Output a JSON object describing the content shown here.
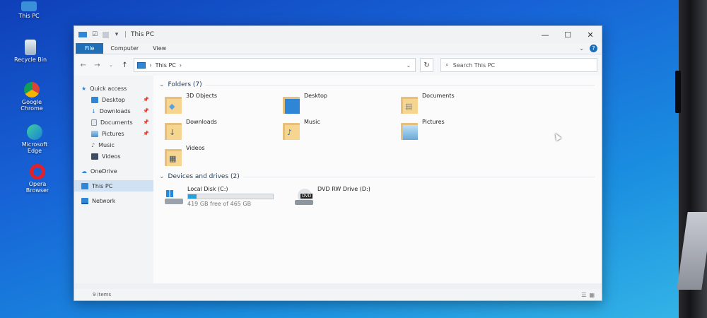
{
  "desktop": {
    "icons": [
      {
        "label": "This PC"
      },
      {
        "label": "Recycle Bin"
      },
      {
        "label": "Google Chrome"
      },
      {
        "label": "Microsoft Edge"
      },
      {
        "label": "Opera Browser"
      }
    ]
  },
  "window": {
    "title": "This PC",
    "controls": {
      "minimize": "—",
      "maximize": "☐",
      "close": "✕"
    },
    "ribbon": {
      "tabs": [
        "File",
        "Computer",
        "View"
      ],
      "expand": "⌄",
      "help": "?"
    },
    "nav": {
      "back": "←",
      "forward": "→",
      "recent": "⌄",
      "up": "↑",
      "address": "This PC",
      "address_sep": "›",
      "address_chevron": "›",
      "address_dropdown": "⌄",
      "refresh": "↻",
      "search_placeholder": "Search This PC"
    },
    "sidebar": {
      "items": [
        {
          "label": "Quick access",
          "pinned": false
        },
        {
          "label": "Desktop",
          "pinned": true
        },
        {
          "label": "Downloads",
          "pinned": true
        },
        {
          "label": "Documents",
          "pinned": true
        },
        {
          "label": "Pictures",
          "pinned": true
        },
        {
          "label": "Music",
          "pinned": false
        },
        {
          "label": "Videos",
          "pinned": false
        },
        {
          "label": "OneDrive",
          "pinned": false
        },
        {
          "label": "This PC",
          "pinned": false
        },
        {
          "label": "Network",
          "pinned": false
        }
      ]
    },
    "folders_header": "Folders (7)",
    "folders": [
      {
        "label": "3D Objects"
      },
      {
        "label": "Desktop"
      },
      {
        "label": "Documents"
      },
      {
        "label": "Downloads"
      },
      {
        "label": "Music"
      },
      {
        "label": "Pictures"
      },
      {
        "label": "Videos"
      }
    ],
    "drives_header": "Devices and drives (2)",
    "drives": [
      {
        "label": "Local Disk (C:)",
        "free_text": "419 GB free of 465 GB",
        "used_fraction": 0.1
      },
      {
        "label": "DVD RW Drive (D:)",
        "badge": "DVD"
      }
    ],
    "status": {
      "item_count": "9 items"
    }
  },
  "colors": {
    "accent": "#1f6fb8",
    "selected": "#cfe1f3",
    "drive_fill": "#26a0da",
    "folder": "#f5d58f"
  }
}
